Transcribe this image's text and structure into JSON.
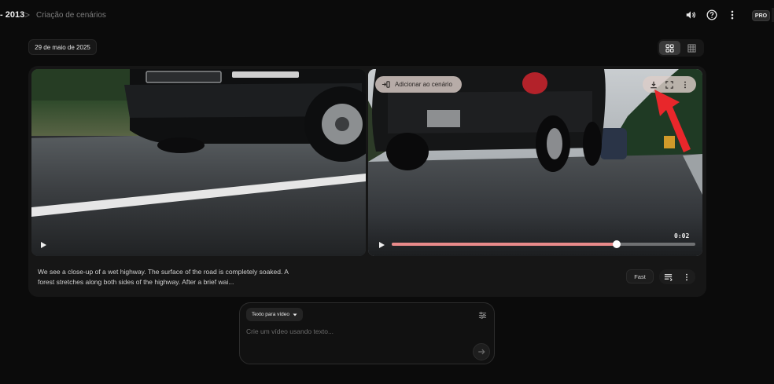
{
  "header": {
    "project_title": "- 2013",
    "separator": ">",
    "page_title": "Criação de cenários",
    "plan_badge": "PRO",
    "icons": [
      "volume-icon",
      "help-icon",
      "more-vertical-icon"
    ]
  },
  "toolbar": {
    "date_label": "29 de maio de 2025",
    "view_modes": [
      "grid-large-icon",
      "grid-small-icon"
    ],
    "active_view": "grid-large-icon"
  },
  "videos": [
    {
      "id": "left",
      "icons": [
        "play-icon"
      ]
    },
    {
      "id": "right",
      "add_to_scene_label": "Adicionar ao cenário",
      "icons": [
        "add-to-scene-icon",
        "download-icon",
        "fullscreen-icon",
        "more-vertical-icon",
        "play-icon"
      ],
      "timecode": "0:02",
      "progress_fraction": 0.74
    }
  ],
  "details": {
    "description": "We see a close-up of a wet highway. The surface of the road is completely soaked. A forest stretches along both sides of the highway. After a brief wai...",
    "model_label": "Fast",
    "icons": [
      "reuse-prompt-icon",
      "more-vertical-icon"
    ]
  },
  "composer": {
    "mode_label": "Texto para vídeo",
    "prompt_placeholder": "Crie um vídeo usando texto...",
    "prompt_value": "",
    "icons": [
      "settings-sliders-icon",
      "arrow-right-icon"
    ]
  },
  "colors": {
    "background": "#0b0b0b",
    "card": "#161616",
    "accent_progress": "#e98a8a",
    "annotation_arrow": "#e8272b"
  }
}
